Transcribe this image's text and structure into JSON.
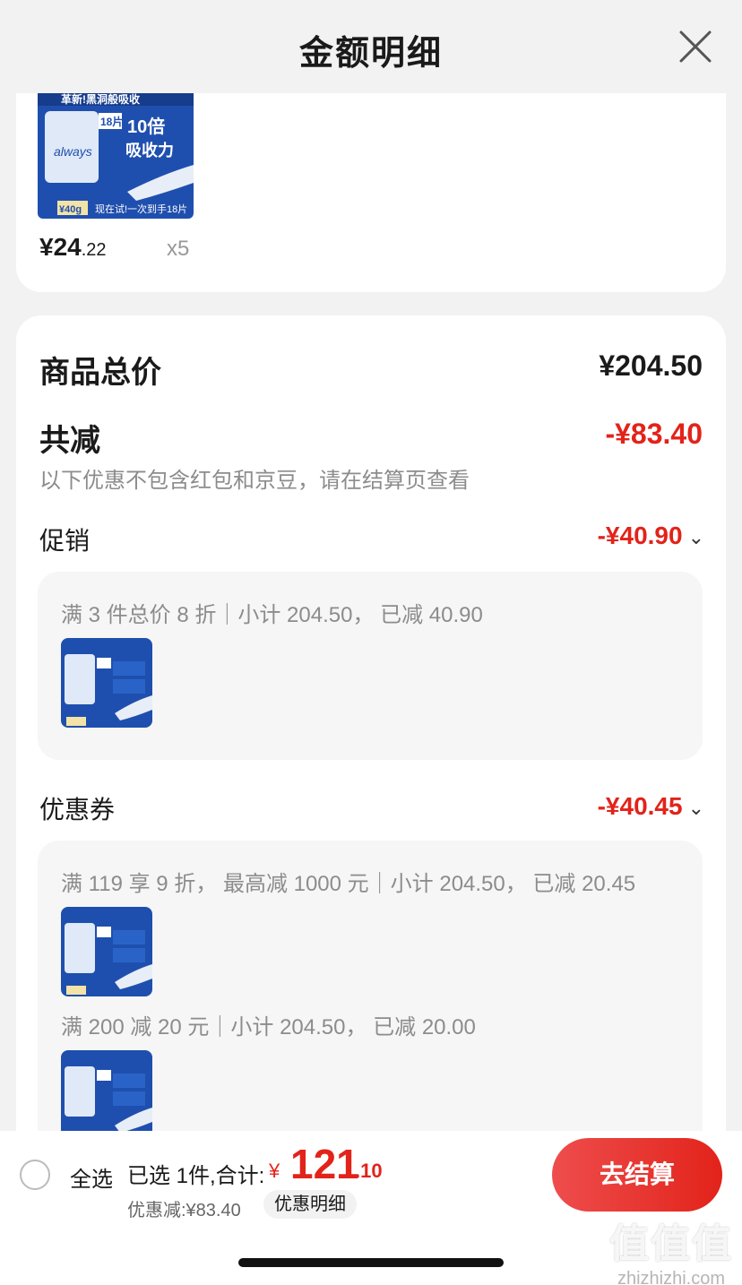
{
  "header": {
    "title": "金额明细"
  },
  "product": {
    "price_int": "¥24",
    "price_dec": ".22",
    "qty": "x5",
    "pack_text_top": "革新!黑洞般吸收",
    "pack_text_mid": "10倍",
    "pack_text_mid2": "吸收力",
    "pack_brand": "always",
    "pack_weight": "¥40g",
    "pack_bottom": "现在试!一次到手18片",
    "pack_count": "18片"
  },
  "summary": {
    "total_label": "商品总价",
    "total_value": "¥204.50",
    "reduce_label": "共减",
    "reduce_value": "-¥83.40",
    "note": "以下优惠不包含红包和京豆，请在结算页查看"
  },
  "promotion": {
    "label": "促销",
    "value": "-¥40.90",
    "detail": "满 3 件总价 8 折｜小计 204.50， 已减 40.90"
  },
  "coupon": {
    "label": "优惠券",
    "value": "-¥40.45",
    "detail1": "满 119 享 9 折， 最高减 1000 元｜小计 204.50， 已减 20.45",
    "detail2": "满 200 减 20 元｜小计 204.50， 已减 20.00"
  },
  "bottom": {
    "select_all": "全选",
    "selected": "已选 1件,合计:",
    "total_symbol": "¥",
    "total_int": "121",
    "total_dec": ".10",
    "discount": "优惠减:¥83.40",
    "detail_chip": "优惠明细",
    "checkout": "去结算"
  },
  "watermark": {
    "big": "值值值",
    "small": "zhizhizhi.com"
  },
  "colors": {
    "accent": "#e2231a",
    "pack_blue": "#1f4fae"
  },
  "icons": {
    "close": "close-icon",
    "chevron": "chevron-down-icon",
    "radio": "radio-unchecked-icon"
  }
}
